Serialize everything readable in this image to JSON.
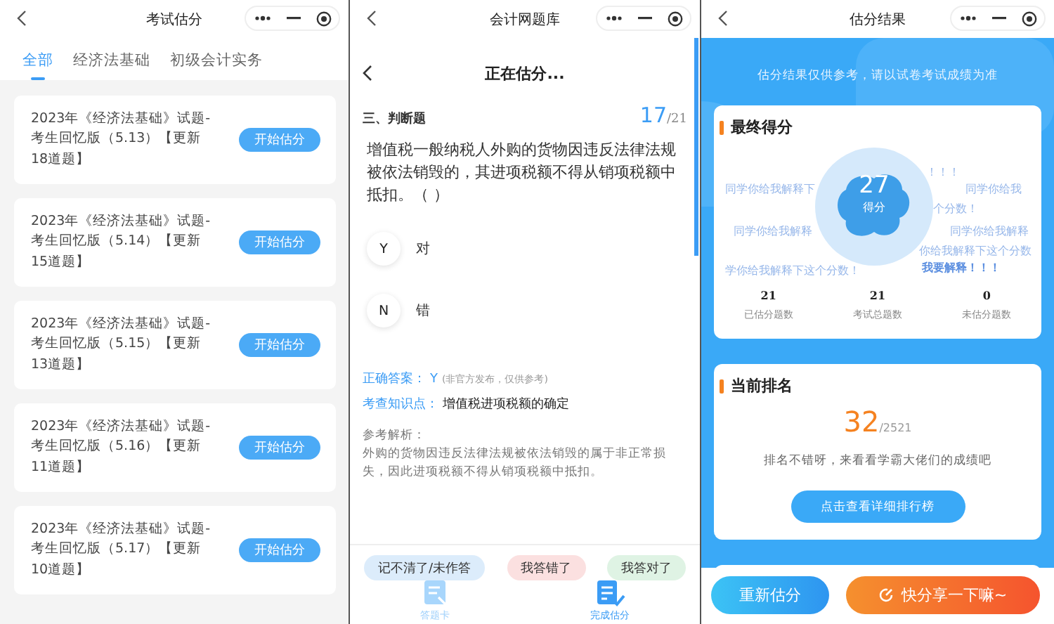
{
  "exam_list": {
    "nav": {
      "title": "考试估分"
    },
    "tabs": [
      {
        "label": "全部",
        "selected": true
      },
      {
        "label": "经济法基础",
        "selected": false
      },
      {
        "label": "初级会计实务",
        "selected": false
      }
    ],
    "items": [
      {
        "title": "2023年《经济法基础》试题-考生回忆版（5.13）【更新18道题】",
        "button": "开始估分"
      },
      {
        "title": "2023年《经济法基础》试题-考生回忆版（5.14）【更新15道题】",
        "button": "开始估分"
      },
      {
        "title": "2023年《经济法基础》试题-考生回忆版（5.15）【更新13道题】",
        "button": "开始估分"
      },
      {
        "title": "2023年《经济法基础》试题-考生回忆版（5.16）【更新11道题】",
        "button": "开始估分"
      },
      {
        "title": "2023年《经济法基础》试题-考生回忆版（5.17）【更新10道题】",
        "button": "开始估分"
      }
    ]
  },
  "estimating": {
    "nav": {
      "title": "会计网题库"
    },
    "header": "正在估分...",
    "section": "三、判断题",
    "progress": {
      "current": "17",
      "total": "/21"
    },
    "question": "增值税一般纳税人外购的货物因违反法律法规被依法销毁的，其进项税额不得从销项税额中抵扣。（   ）",
    "options": [
      {
        "key": "Y",
        "label": "对"
      },
      {
        "key": "N",
        "label": "错"
      }
    ],
    "answer": {
      "label": "正确答案：",
      "value": "Y",
      "note": "(非官方发布，仅供参考)"
    },
    "knowledge": {
      "label": "考查知识点：",
      "value": "增值税进项税额的确定"
    },
    "analysis": {
      "label": "参考解析：",
      "text": "外购的货物因违反法律法规被依法销毁的属于非正常损失，因此进项税额不得从销项税额中抵扣。"
    },
    "self_marks": [
      {
        "label": "记不清了/未作答",
        "kind": "unsure"
      },
      {
        "label": "我答错了",
        "kind": "wrong"
      },
      {
        "label": "我答对了",
        "kind": "right"
      }
    ],
    "bottom_tabs": [
      {
        "label": "答题卡",
        "selected": false
      },
      {
        "label": "完成估分",
        "selected": true
      }
    ]
  },
  "result": {
    "nav": {
      "title": "估分结果"
    },
    "notice": "估分结果仅供参考，请以试卷考试成绩为准",
    "score_card": {
      "title": "最终得分",
      "score": "27",
      "score_label": "得分",
      "danmaku": [
        {
          "text": "！！！",
          "kind": "normal"
        },
        {
          "text": "同学你给我解释下",
          "kind": "normal"
        },
        {
          "text": "同学你给我",
          "kind": "normal"
        },
        {
          "text": "个分数！",
          "kind": "normal"
        },
        {
          "text": "同学你给我解释",
          "kind": "normal"
        },
        {
          "text": "同学你给我解释",
          "kind": "normal"
        },
        {
          "text": "你给我解释下这个分数",
          "kind": "normal"
        },
        {
          "text": "学你给我解释下这个分数！",
          "kind": "normal"
        },
        {
          "text": "我要解释！！！",
          "kind": "highlight"
        }
      ],
      "stats": [
        {
          "value": "21",
          "label": "已估分题数"
        },
        {
          "value": "21",
          "label": "考试总题数"
        },
        {
          "value": "0",
          "label": "未估分题数"
        }
      ]
    },
    "rank_card": {
      "title": "当前排名",
      "rank": "32",
      "total": "/2521",
      "message": "排名不错呀，来看看学霸大佬们的成绩吧",
      "button": "点击查看详细排行榜"
    },
    "actions": [
      {
        "label": "重新估分",
        "kind": "secondary"
      },
      {
        "label": "快分享一下嘛~",
        "kind": "share"
      }
    ]
  }
}
